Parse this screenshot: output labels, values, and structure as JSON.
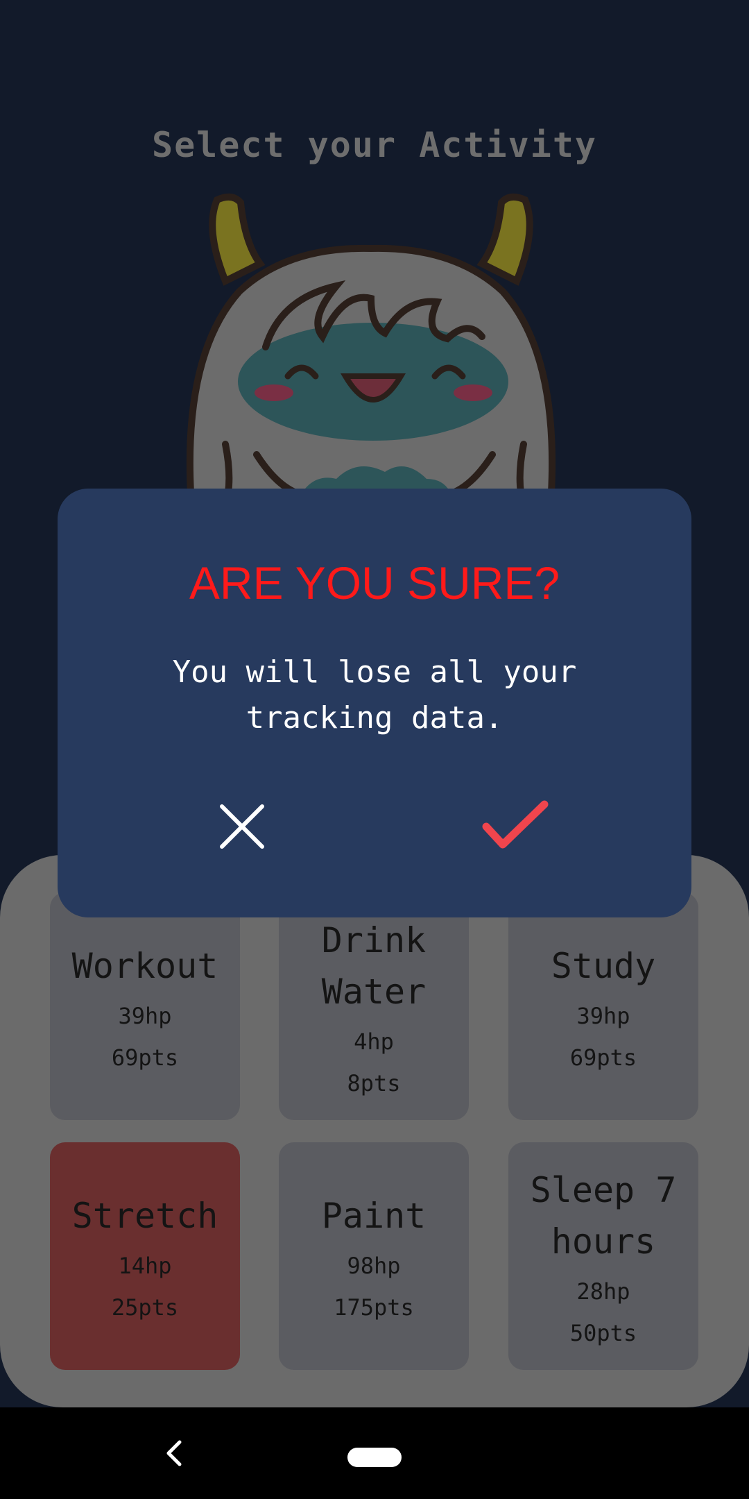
{
  "screen": {
    "title": "Select your Activity"
  },
  "mascot": {
    "icon": "yeti-mascot-icon"
  },
  "activities": [
    {
      "name": "Workout",
      "hp": "39hp",
      "pts": "69pts",
      "selected": false
    },
    {
      "name": "Drink Water",
      "hp": "4hp",
      "pts": "8pts",
      "selected": false
    },
    {
      "name": "Study",
      "hp": "39hp",
      "pts": "69pts",
      "selected": false
    },
    {
      "name": "Stretch",
      "hp": "14hp",
      "pts": "25pts",
      "selected": true
    },
    {
      "name": "Paint",
      "hp": "98hp",
      "pts": "175pts",
      "selected": false
    },
    {
      "name": "Sleep 7 hours",
      "hp": "28hp",
      "pts": "50pts",
      "selected": false
    }
  ],
  "dialog": {
    "title": "ARE YOU SURE?",
    "message": "You will lose all your tracking data.",
    "cancel_icon": "close-icon",
    "confirm_icon": "checkmark-icon"
  },
  "colors": {
    "background": "#121a2a",
    "dialog": "#273a5e",
    "title_red": "#ff1a1a",
    "confirm_red": "#f0454d",
    "selected_card": "#6a2f2f"
  },
  "navbar": {
    "back_icon": "back-chevron-icon",
    "home_icon": "home-pill-icon"
  }
}
